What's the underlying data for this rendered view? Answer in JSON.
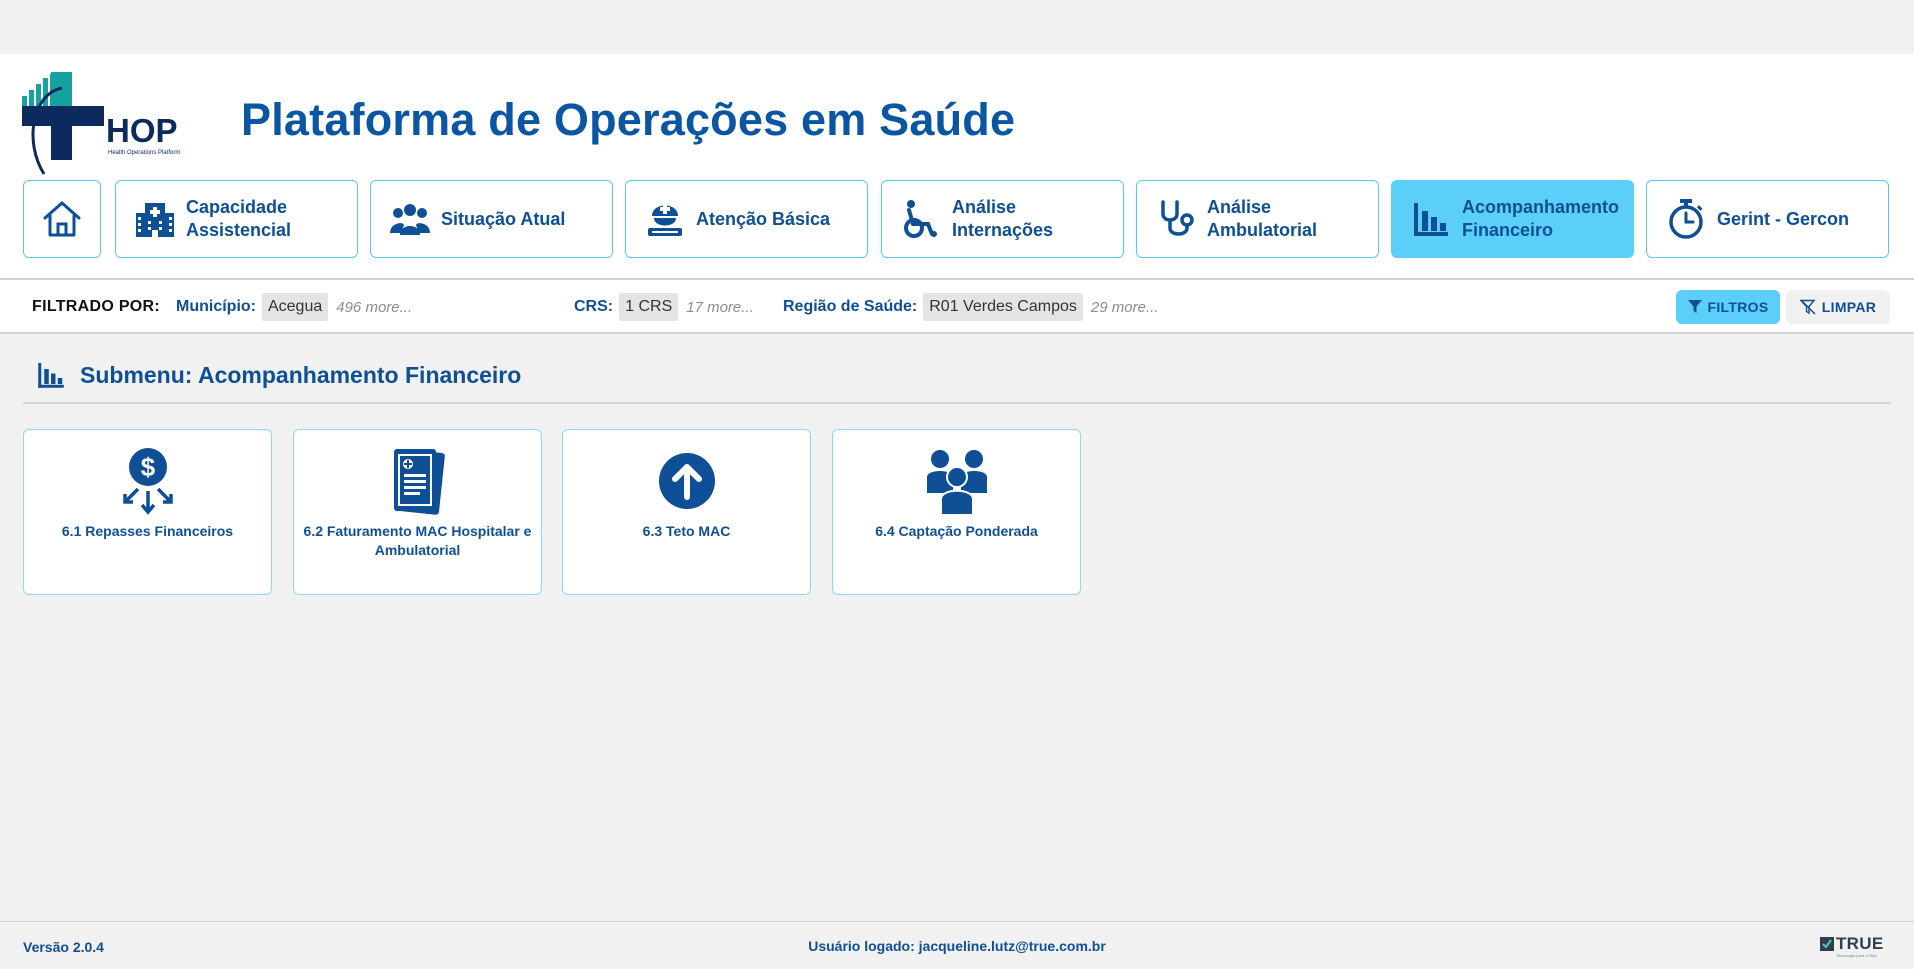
{
  "app": {
    "logo_text": "HOP",
    "logo_subtext": "Health Operations Platform",
    "title": "Plataforma de Operações em Saúde"
  },
  "nav": {
    "home_label": "Home",
    "items": [
      {
        "label": "Capacidade Assistencial",
        "icon": "hospital-icon",
        "active": false
      },
      {
        "label": "Situação Atual",
        "icon": "people-group-icon",
        "active": false
      },
      {
        "label": "Atenção Básica",
        "icon": "nurse-icon",
        "active": false
      },
      {
        "label": "Análise Internações",
        "icon": "wheelchair-icon",
        "active": false
      },
      {
        "label": "Análise Ambulatorial",
        "icon": "stethoscope-icon",
        "active": false
      },
      {
        "label": "Acompanhamento Financeiro",
        "icon": "bar-chart-icon",
        "active": true
      },
      {
        "label": "Gerint - Gercon",
        "icon": "stopwatch-icon",
        "active": false
      }
    ]
  },
  "filters": {
    "title": "FILTRADO POR:",
    "municipio": {
      "label": "Município:",
      "value": "Acegua",
      "more": "496 more..."
    },
    "crs": {
      "label": "CRS:",
      "value": "1 CRS",
      "more": "17 more..."
    },
    "regiao": {
      "label": "Região de Saúde:",
      "value": "R01 Verdes Campos",
      "more": "29 more..."
    },
    "filtros_label": "FILTROS",
    "limpar_label": "LIMPAR"
  },
  "submenu": {
    "title": "Submenu: Acompanhamento Financeiro",
    "cards": [
      {
        "label": "6.1 Repasses Financeiros",
        "icon": "money-transfer-icon"
      },
      {
        "label": "6.2 Faturamento MAC Hospitalar e Ambulatorial",
        "icon": "medical-document-icon"
      },
      {
        "label": "6.3 Teto MAC",
        "icon": "arrow-up-circle-icon"
      },
      {
        "label": "6.4 Captação Ponderada",
        "icon": "users-group-icon"
      }
    ]
  },
  "footer": {
    "version": "Versão 2.0.4",
    "user": "Usuário logado: jacqueline.lutz@true.com.br",
    "brand": "TRUE",
    "brand_sub": "Tecnologia para a Vida"
  },
  "colors": {
    "primary": "#0e4f96",
    "accent": "#5ccff9",
    "border": "#5ac8f5",
    "logo_teal": "#17a2a2",
    "logo_navy": "#0d2a5e"
  }
}
